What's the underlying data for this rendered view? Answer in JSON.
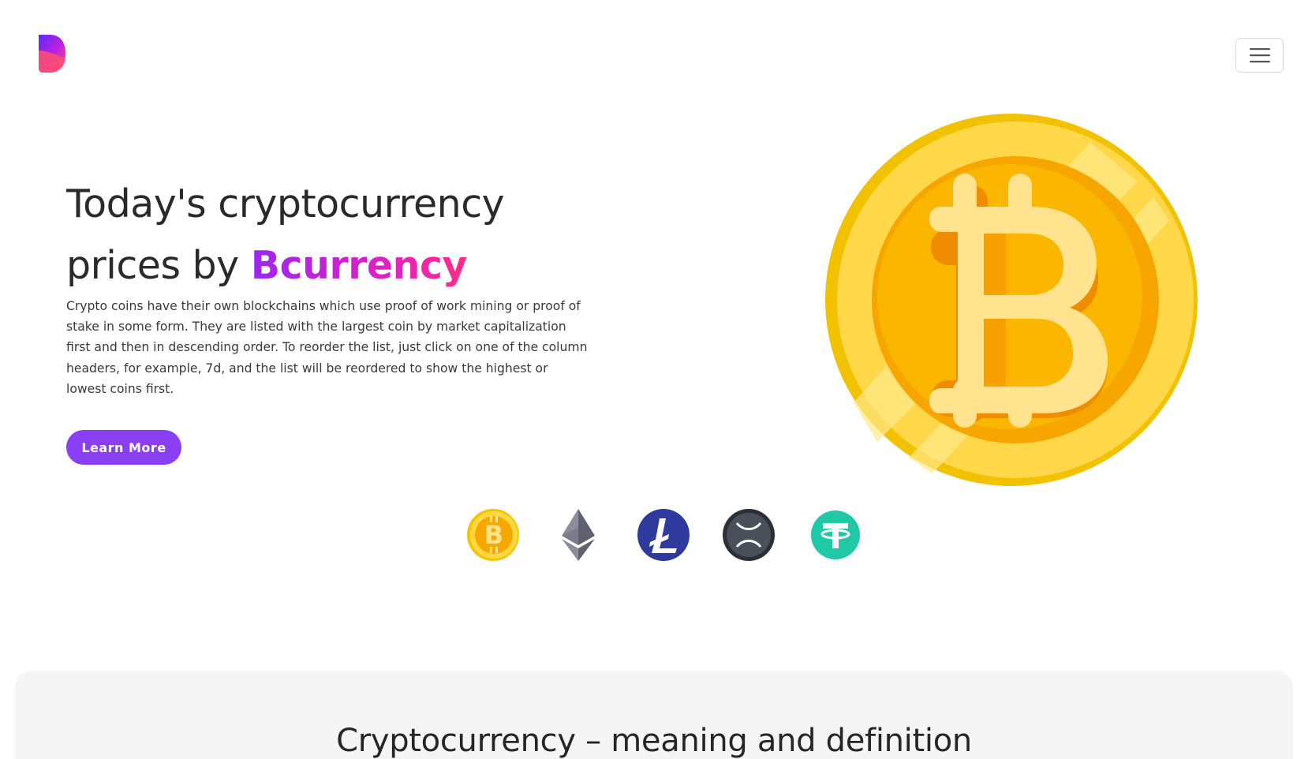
{
  "header": {
    "logo_icon": "bcurrency-logo-icon",
    "menu_icon": "hamburger-menu-icon"
  },
  "hero": {
    "title_line1": "Today's cryptocurrency",
    "title_line2_prefix": "prices by ",
    "brand": "Bcurrency",
    "description": "Crypto coins have their own blockchains which use proof of work mining or proof of stake in some form. They are listed with the largest coin by market capitalization first and then in descending order. To reorder the list, just click on one of the column headers, for example, 7d, and the list will be reordered to show the highest or lowest coins first.",
    "cta_label": "Learn More",
    "illustration_icon": "bitcoin-coin-icon"
  },
  "coins": [
    {
      "name": "bitcoin-icon",
      "color": "#f7b500"
    },
    {
      "name": "ethereum-icon",
      "color": "#6b6f7c"
    },
    {
      "name": "litecoin-icon",
      "color": "#2f3a9e"
    },
    {
      "name": "xrp-icon",
      "color": "#3a3f47"
    },
    {
      "name": "tether-icon",
      "color": "#1fc9a6"
    }
  ],
  "section": {
    "title": "Cryptocurrency – meaning and definition"
  },
  "colors": {
    "accent": "#8a3ff5",
    "brand_gradient_start": "#9c27f0",
    "brand_gradient_end": "#ff2d87",
    "section_bg": "#f5f5f5"
  }
}
